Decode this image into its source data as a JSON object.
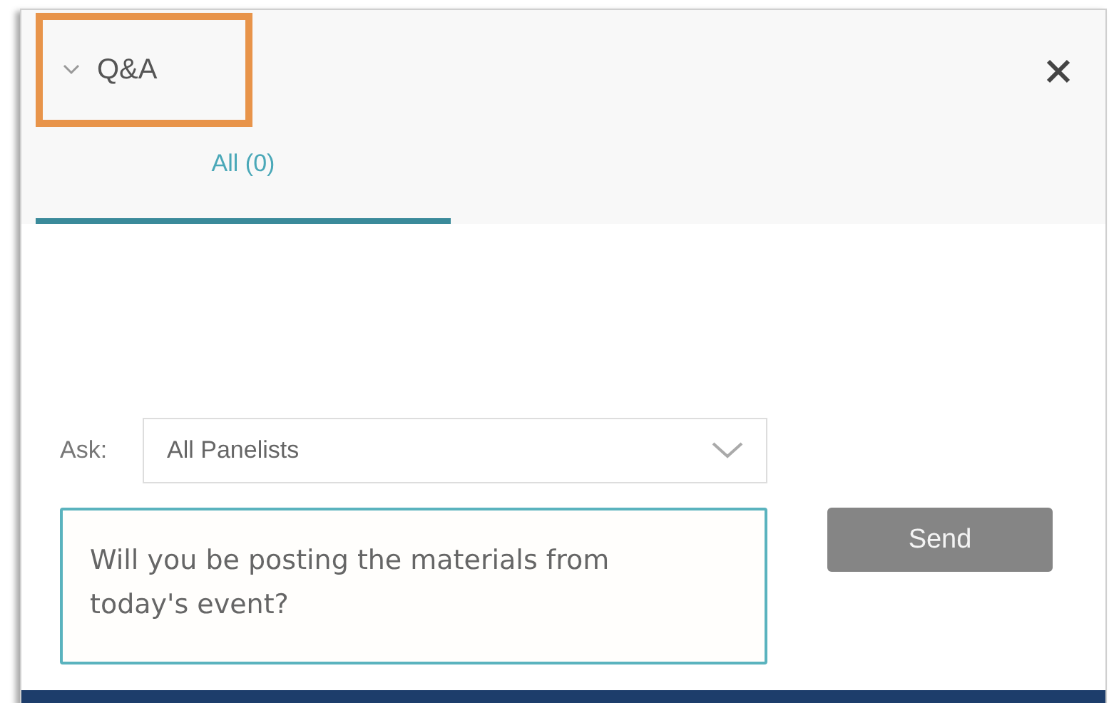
{
  "panel": {
    "title": "Q&A",
    "highlighted": true
  },
  "tabs": [
    {
      "label": "All (0)",
      "selected": true
    }
  ],
  "ask": {
    "label": "Ask:",
    "value": "All Panelists"
  },
  "question": {
    "value": "Will you be posting the materials from today's event?"
  },
  "send_button": "Send"
}
